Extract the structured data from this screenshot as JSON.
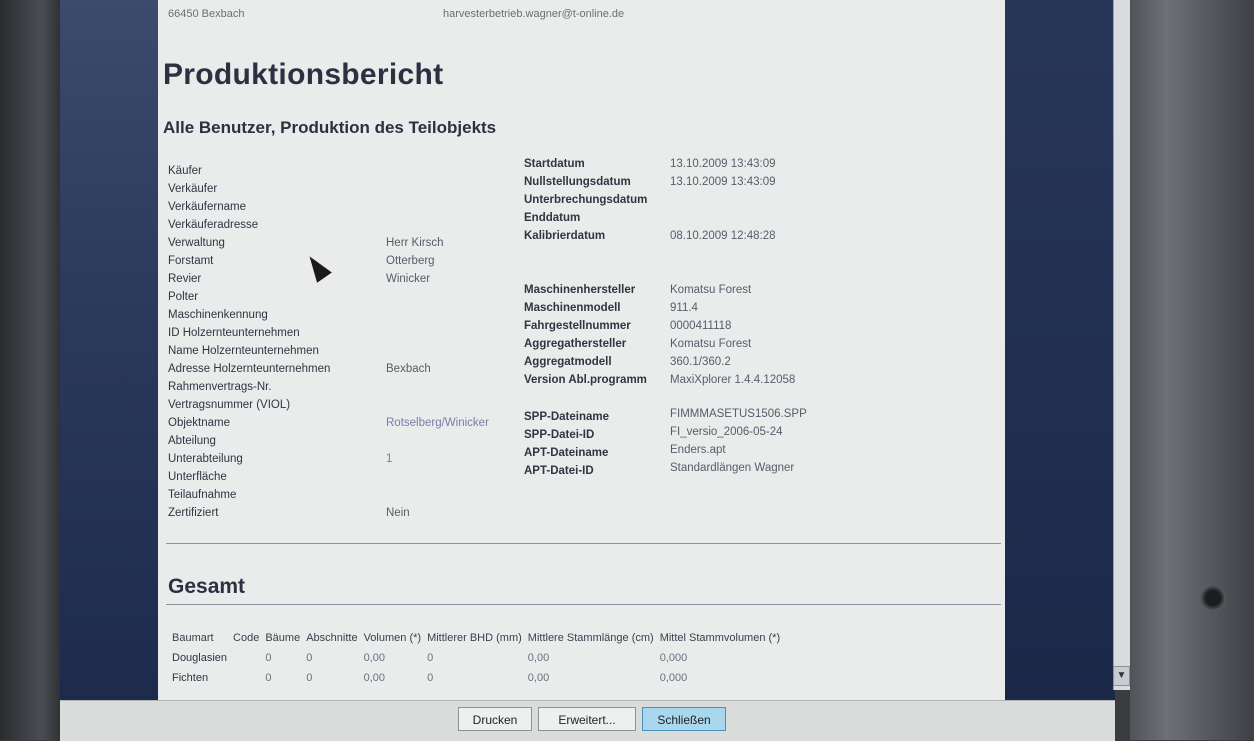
{
  "header": {
    "address": "66450 Bexbach",
    "email": "harvesterbetrieb.wagner@t-online.de"
  },
  "report": {
    "title": "Produktionsbericht",
    "subtitle": "Alle Benutzer, Produktion des Teilobjekts"
  },
  "left_fields": [
    {
      "label": "Käufer",
      "value": ""
    },
    {
      "label": "Verkäufer",
      "value": ""
    },
    {
      "label": "Verkäufername",
      "value": ""
    },
    {
      "label": "Verkäuferadresse",
      "value": ""
    },
    {
      "label": "Verwaltung",
      "value": "Herr Kirsch"
    },
    {
      "label": "Forstamt",
      "value": "Otterberg"
    },
    {
      "label": "Revier",
      "value": "Winicker"
    },
    {
      "label": "Polter",
      "value": ""
    },
    {
      "label": "Maschinenkennung",
      "value": ""
    },
    {
      "label": "ID Holzernteunternehmen",
      "value": ""
    },
    {
      "label": "Name Holzernteunternehmen",
      "value": ""
    },
    {
      "label": "Adresse Holzernteunternehmen",
      "value": "Bexbach"
    },
    {
      "label": "Rahmenvertrags-Nr.",
      "value": ""
    },
    {
      "label": "Vertragsnummer (VIOL)",
      "value": ""
    },
    {
      "label": "Objektname",
      "value": "Rotselberg/Winicker"
    },
    {
      "label": "Abteilung",
      "value": ""
    },
    {
      "label": "Unterabteilung",
      "value": "1"
    },
    {
      "label": "Unterfläche",
      "value": ""
    },
    {
      "label": "Teilaufnahme",
      "value": ""
    },
    {
      "label": "Zertifiziert",
      "value": "Nein"
    }
  ],
  "dates": [
    {
      "label": "Startdatum",
      "value": "13.10.2009 13:43:09"
    },
    {
      "label": "Nullstellungsdatum",
      "value": "13.10.2009 13:43:09"
    },
    {
      "label": "Unterbrechungsdatum",
      "value": ""
    },
    {
      "label": "Enddatum",
      "value": ""
    },
    {
      "label": "Kalibrierdatum",
      "value": "08.10.2009 12:48:28"
    }
  ],
  "machine": [
    {
      "label": "Maschinenhersteller",
      "value": "Komatsu Forest"
    },
    {
      "label": "Maschinenmodell",
      "value": "911.4"
    },
    {
      "label": "Fahrgestellnummer",
      "value": "0000411118"
    },
    {
      "label": "Aggregathersteller",
      "value": "Komatsu Forest"
    },
    {
      "label": "Aggregatmodell",
      "value": "360.1/360.2"
    },
    {
      "label": "Version Abl.programm",
      "value": "MaxiXplorer 1.4.4.12058"
    }
  ],
  "files": [
    {
      "label": "SPP-Dateiname",
      "value": "FIMMMASETUS1506.SPP"
    },
    {
      "label": "SPP-Datei-ID",
      "value": "FI_versio_2006-05-24"
    },
    {
      "label": "APT-Dateiname",
      "value": "Enders.apt"
    },
    {
      "label": "APT-Datei-ID",
      "value": "Standardlängen Wagner"
    }
  ],
  "summary": {
    "heading": "Gesamt",
    "columns": [
      "Baumart",
      "Code",
      "Bäume",
      "Abschnitte",
      "Volumen (*)",
      "Mittlerer BHD (mm)",
      "Mittlere Stammlänge (cm)",
      "Mittel Stammvolumen (*)"
    ],
    "rows": [
      [
        "Douglasien",
        "",
        "0",
        "0",
        "0,00",
        "0",
        "0,00",
        "0,000"
      ],
      [
        "Fichten",
        "",
        "0",
        "0",
        "0,00",
        "0",
        "0,00",
        "0,000"
      ]
    ]
  },
  "buttons": {
    "print": "Drucken",
    "advanced": "Erweitert...",
    "close": "Schließen"
  },
  "colors": {
    "accent_button": "#a9d7ee",
    "document_bg": "#e9eceb"
  }
}
